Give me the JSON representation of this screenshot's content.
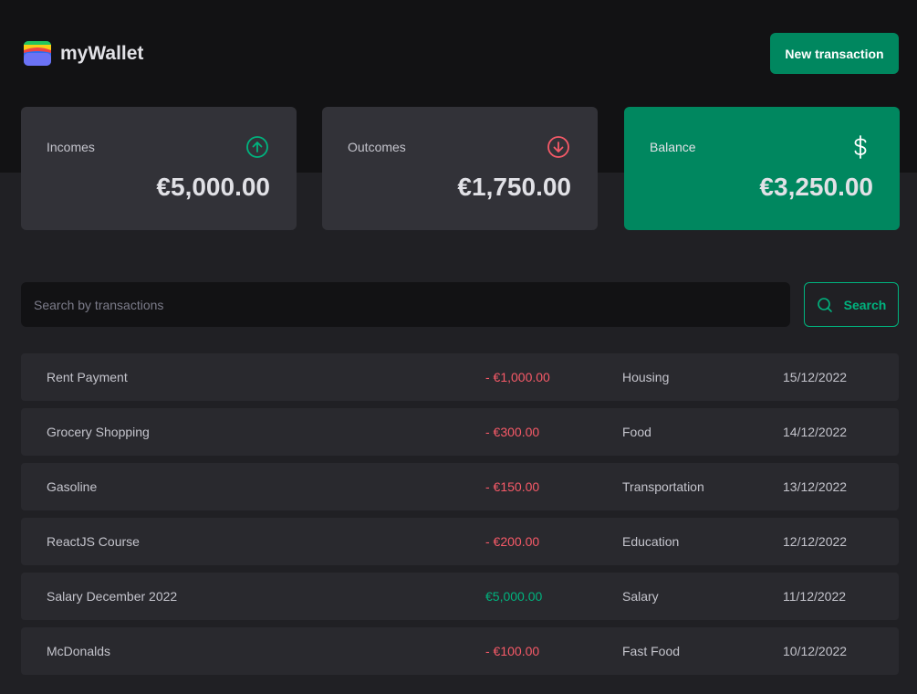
{
  "header": {
    "app_name": "myWallet",
    "new_transaction_label": "New transaction"
  },
  "summary": {
    "incomes": {
      "label": "Incomes",
      "value": "€5,000.00",
      "icon": "arrow-circle-up-icon",
      "color": "#00b37e"
    },
    "outcomes": {
      "label": "Outcomes",
      "value": "€1,750.00",
      "icon": "arrow-circle-down-icon",
      "color": "#f75a68"
    },
    "balance": {
      "label": "Balance",
      "value": "€3,250.00",
      "icon": "dollar-icon",
      "color": "#00875f"
    }
  },
  "search": {
    "placeholder": "Search by transactions",
    "value": "",
    "button_label": "Search"
  },
  "transactions": [
    {
      "description": "Rent Payment",
      "amount": "- €1,000.00",
      "type": "outcome",
      "category": "Housing",
      "date": "15/12/2022"
    },
    {
      "description": "Grocery Shopping",
      "amount": "- €300.00",
      "type": "outcome",
      "category": "Food",
      "date": "14/12/2022"
    },
    {
      "description": "Gasoline",
      "amount": "- €150.00",
      "type": "outcome",
      "category": "Transportation",
      "date": "13/12/2022"
    },
    {
      "description": "ReactJS Course",
      "amount": "- €200.00",
      "type": "outcome",
      "category": "Education",
      "date": "12/12/2022"
    },
    {
      "description": "Salary December 2022",
      "amount": "€5,000.00",
      "type": "income",
      "category": "Salary",
      "date": "11/12/2022"
    },
    {
      "description": "McDonalds",
      "amount": "- €100.00",
      "type": "outcome",
      "category": "Fast Food",
      "date": "10/12/2022"
    }
  ],
  "colors": {
    "background": "#202024",
    "header_background": "#121214",
    "brand_green": "#00875f",
    "income_green": "#00b37e",
    "outcome_red": "#f75a68"
  }
}
